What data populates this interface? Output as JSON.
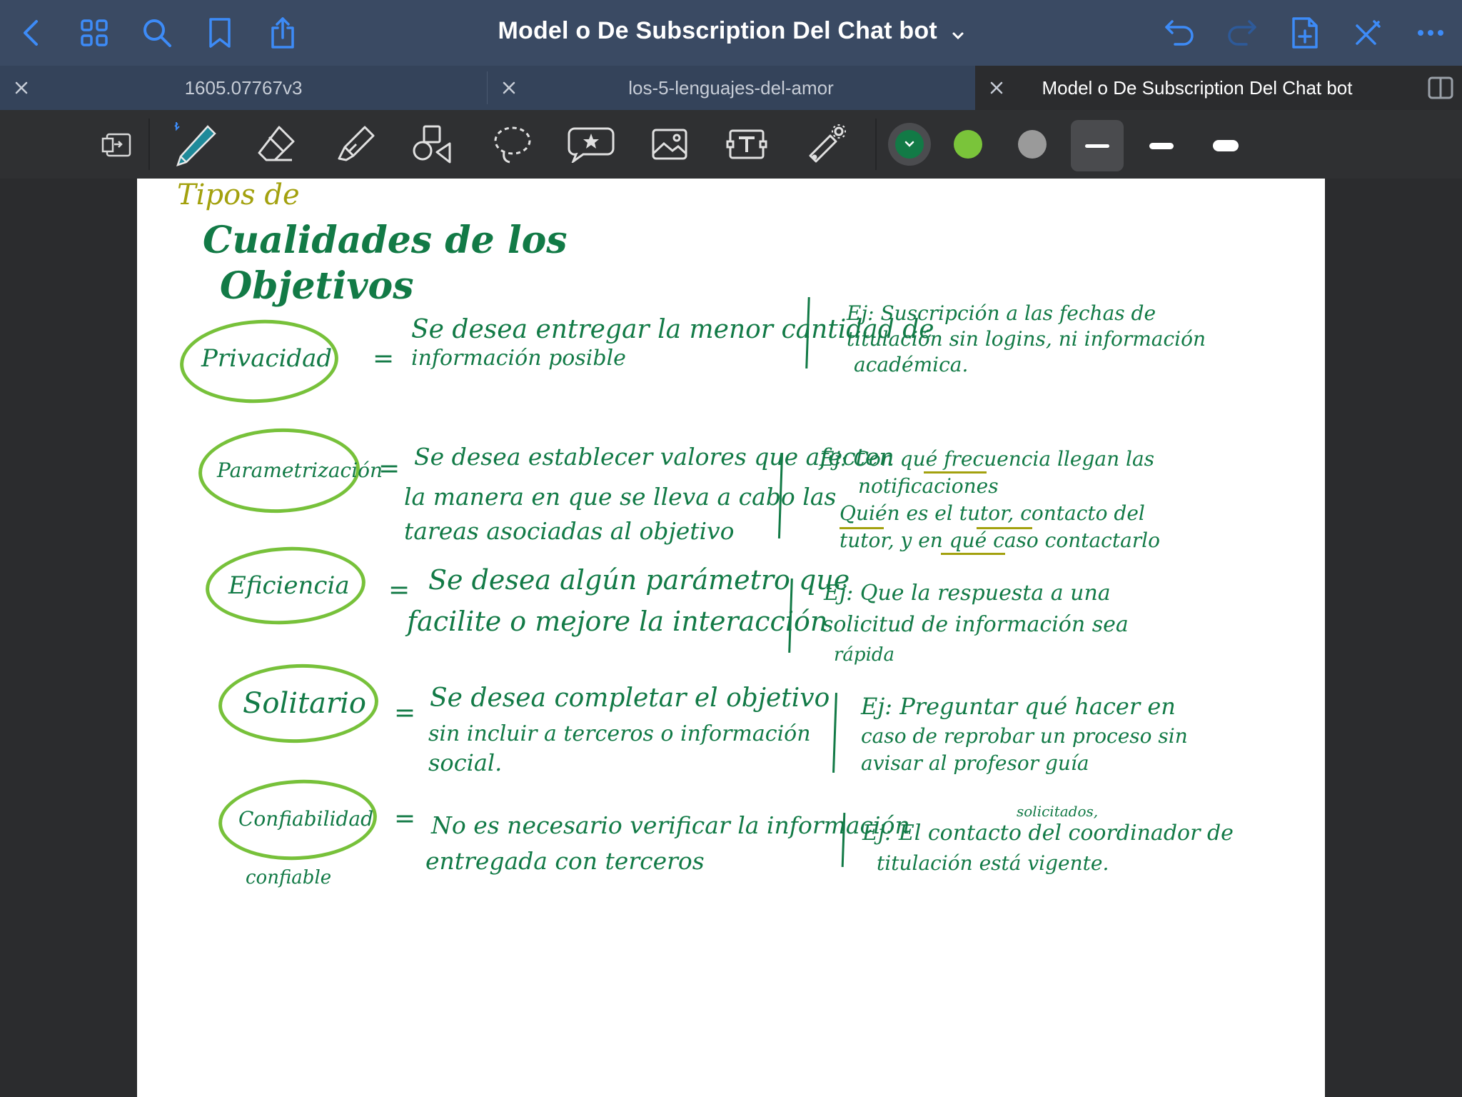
{
  "nav": {
    "title": "Model o De Subscription Del Chat bot",
    "icons": [
      "back-icon",
      "grid-icon",
      "search-icon",
      "bookmark-icon",
      "share-icon",
      "undo-icon",
      "redo-icon",
      "add-page-icon",
      "close-pen-icon",
      "more-icon"
    ]
  },
  "tabs": [
    {
      "label": "1605.07767v3"
    },
    {
      "label": "los-5-lenguajes-del-amor"
    },
    {
      "label": "Model o De Subscription Del Chat bot"
    }
  ],
  "toolbar": {
    "tools": [
      "read-only-icon",
      "pen-icon",
      "eraser-icon",
      "highlighter-icon",
      "shapes-icon",
      "lasso-icon",
      "elements-icon",
      "image-icon",
      "text-icon",
      "laser-pointer-icon"
    ],
    "colors": {
      "selected": "#127a46",
      "green": "#7ac43a",
      "gray": "#9a9a9a"
    }
  },
  "notes": {
    "heading_small": "Tipos de",
    "heading_line1": "Cualidades de los",
    "heading_line2": "Objetivos",
    "rows": [
      {
        "label": "Privacidad",
        "eq": "=",
        "def": [
          "Se desea entregar la menor cantidad de",
          "información posible"
        ],
        "ex": [
          "Ej: Suscripción a las fechas de",
          "titulación sin logins, ni información",
          "académica."
        ]
      },
      {
        "label": "Parametrización",
        "eq": "=",
        "def": [
          "Se desea establecer valores que afecten",
          "la manera en que se lleva a cabo las",
          "tareas asociadas al objetivo"
        ],
        "ex": [
          "Ej: Con qué frecuencia llegan las",
          "notificaciones",
          "Quién es el tutor, contacto del",
          "tutor, y en qué caso contactarlo"
        ]
      },
      {
        "label": "Eficiencia",
        "eq": "=",
        "def": [
          "Se desea algún parámetro que",
          "facilite o mejore la interacción"
        ],
        "ex": [
          "Ej: Que la respuesta a una",
          "solicitud de información sea",
          "rápida"
        ]
      },
      {
        "label": "Solitario",
        "eq": "=",
        "def": [
          "Se desea completar el objetivo",
          "sin incluir a terceros o información",
          "social."
        ],
        "ex": [
          "Ej: Preguntar qué hacer en",
          "caso de reprobar un proceso sin",
          "avisar al profesor guía"
        ]
      },
      {
        "label": "Confiabilidad",
        "sub": "confiable",
        "eq": "=",
        "def": [
          "No es necesario verificar la información",
          "entregada con terceros"
        ],
        "ex": [
          "Ej: El contacto del coordinador de",
          "titulación está vigente."
        ],
        "ex_note": "solicitados,"
      }
    ]
  }
}
